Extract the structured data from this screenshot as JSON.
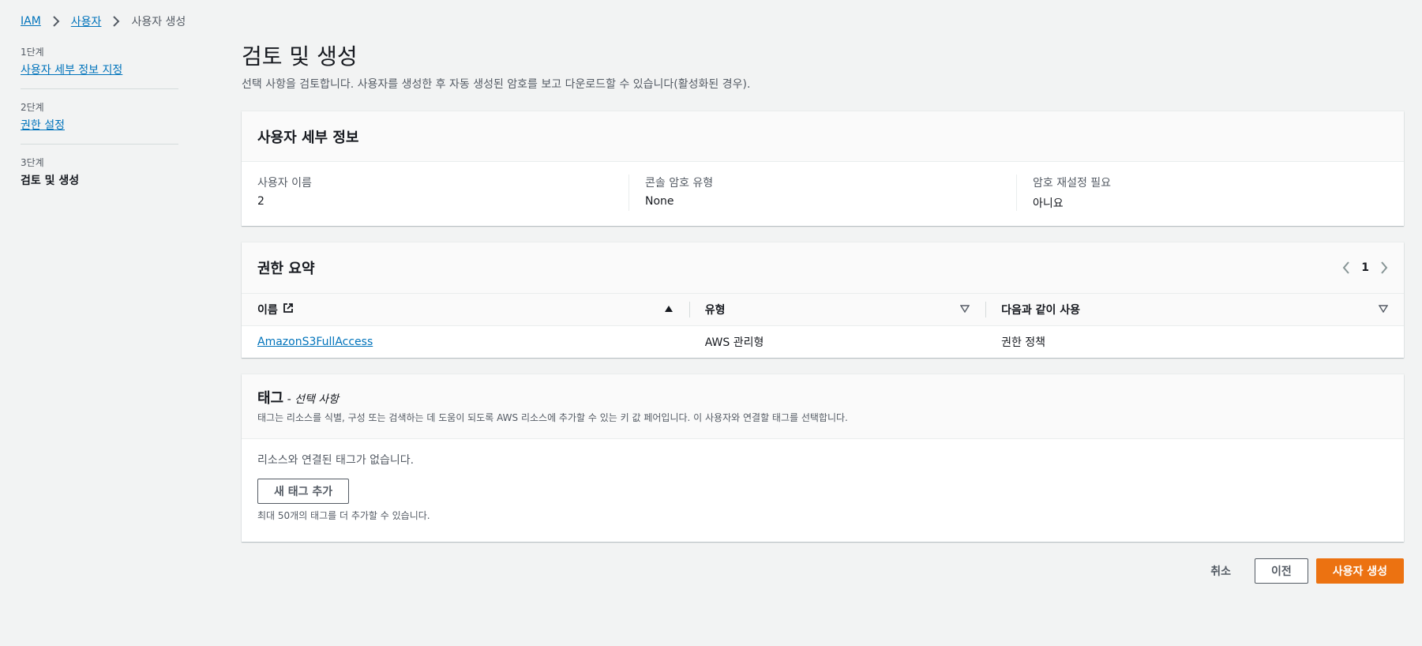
{
  "breadcrumb": {
    "items": [
      "IAM",
      "사용자"
    ],
    "current": "사용자 생성"
  },
  "steps": [
    {
      "num": "1단계",
      "label": "사용자 세부 정보 지정"
    },
    {
      "num": "2단계",
      "label": "권한 설정"
    },
    {
      "num": "3단계",
      "label": "검토 및 생성"
    }
  ],
  "page": {
    "title": "검토 및 생성",
    "description": "선택 사항을 검토합니다. 사용자를 생성한 후 자동 생성된 암호를 보고 다운로드할 수 있습니다(활성화된 경우)."
  },
  "user_details": {
    "title": "사용자 세부 정보",
    "fields": [
      {
        "key": "사용자 이름",
        "value": "2"
      },
      {
        "key": "콘솔 암호 유형",
        "value": "None"
      },
      {
        "key": "암호 재설정 필요",
        "value": "아니요"
      }
    ]
  },
  "permissions": {
    "title": "권한 요약",
    "page": "1",
    "columns": [
      "이름",
      "유형",
      "다음과 같이 사용"
    ],
    "rows": [
      {
        "name": "AmazonS3FullAccess",
        "type": "AWS 관리형",
        "used_as": "권한 정책"
      }
    ]
  },
  "tags": {
    "title": "태그",
    "optional": "- 선택 사항",
    "description": "태그는 리소스를 식별, 구성 또는 검색하는 데 도움이 되도록 AWS 리소스에 추가할 수 있는 키 값 페어입니다. 이 사용자와 연결할 태그를 선택합니다.",
    "empty": "리소스와 연결된 태그가 없습니다.",
    "add_button": "새 태그 추가",
    "limit": "최대 50개의 태그를 더 추가할 수 있습니다."
  },
  "actions": {
    "cancel": "취소",
    "previous": "이전",
    "create": "사용자 생성"
  },
  "colors": {
    "link": "#0073bb",
    "primary": "#ec7211",
    "background": "#f2f3f3"
  }
}
